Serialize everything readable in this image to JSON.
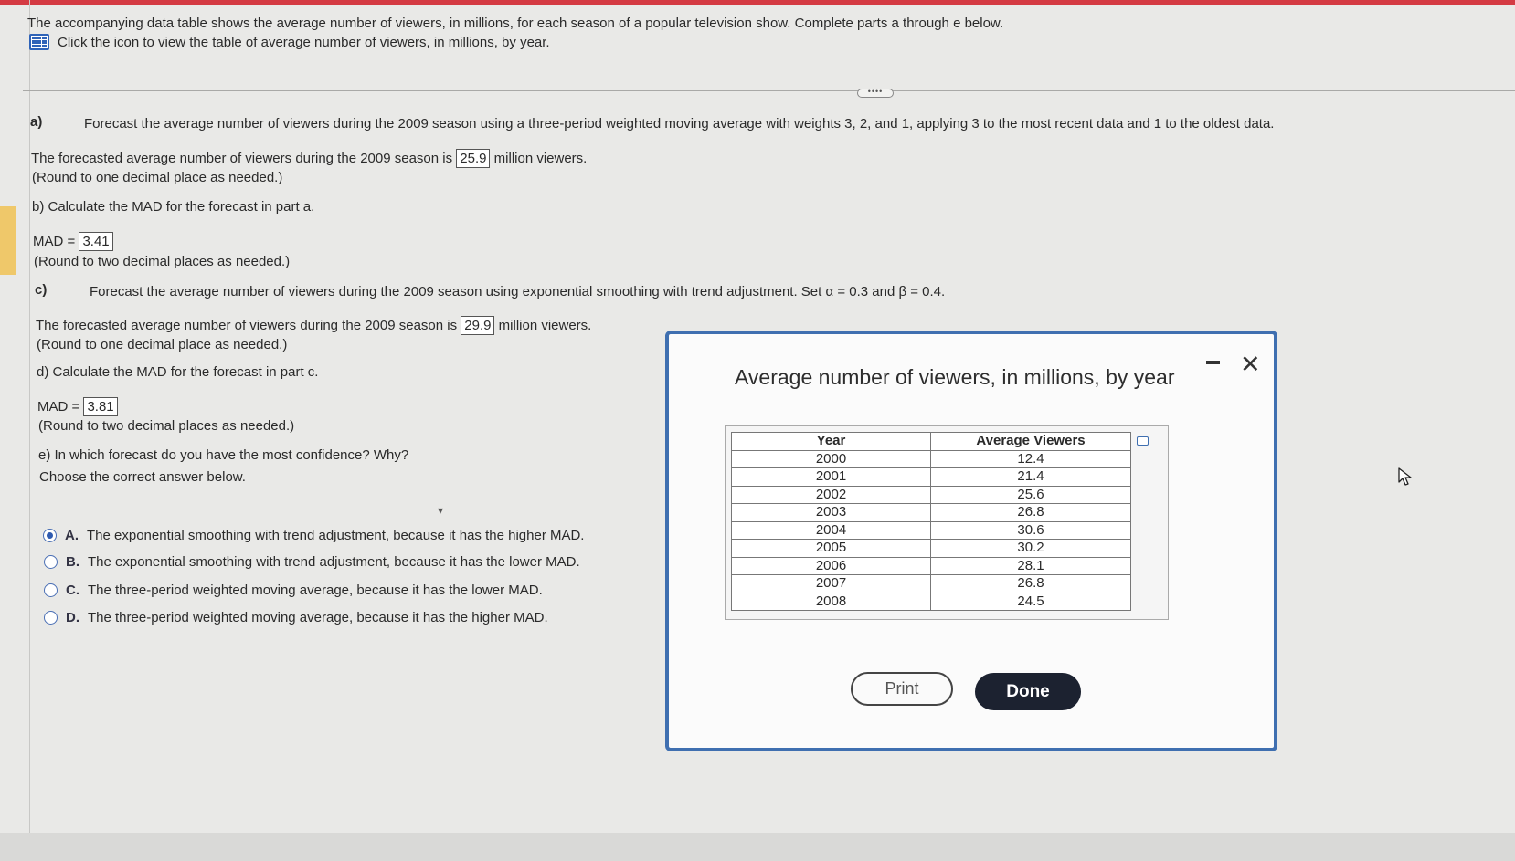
{
  "intro": {
    "text": "The accompanying data table shows the average number of viewers, in millions, for each season of a popular television show. Complete parts a through e below.",
    "table_link": "Click the icon to view the table of average number of viewers, in millions, by year."
  },
  "part_a": {
    "letter": "a)",
    "question": "Forecast the average number of viewers during the 2009 season using a three-period weighted moving average with weights 3, 2, and 1, applying 3 to the most recent data and 1 to the oldest data.",
    "answer_prefix": "The forecasted average number of viewers during the 2009 season is",
    "answer_value": "25.9",
    "answer_suffix": "million viewers.",
    "hint": "(Round to one decimal place as needed.)"
  },
  "part_b": {
    "question": "b) Calculate the MAD for the forecast in part a.",
    "label": "MAD =",
    "answer_value": "3.41",
    "hint": "(Round to two decimal places as needed.)"
  },
  "part_c": {
    "letter": "c)",
    "question": "Forecast the average number of viewers during the 2009 season using exponential smoothing with trend adjustment. Set α = 0.3 and β = 0.4.",
    "answer_prefix": "The forecasted average number of viewers during the 2009 season is",
    "answer_value": "29.9",
    "answer_suffix": "million viewers.",
    "hint": "(Round to one decimal place as needed.)"
  },
  "part_d": {
    "question": "d) Calculate the MAD for the forecast in part c.",
    "label": "MAD =",
    "answer_value": "3.81",
    "hint": "(Round to two decimal places as needed.)"
  },
  "part_e": {
    "question": "e) In which forecast do you have the most confidence? Why?",
    "instruction": "Choose the correct answer below.",
    "choices": [
      {
        "letter": "A.",
        "text": "The exponential smoothing with trend adjustment, because it has the higher MAD.",
        "selected": true
      },
      {
        "letter": "B.",
        "text": "The exponential smoothing with trend adjustment, because it has the lower MAD.",
        "selected": false
      },
      {
        "letter": "C.",
        "text": "The three-period weighted moving average, because it has the lower MAD.",
        "selected": false
      },
      {
        "letter": "D.",
        "text": "The three-period weighted moving average, because it has the higher MAD.",
        "selected": false
      }
    ]
  },
  "dialog": {
    "title": "Average number of viewers, in millions, by year",
    "table": {
      "headers": [
        "Year",
        "Average Viewers"
      ],
      "rows": [
        [
          "2000",
          "12.4"
        ],
        [
          "2001",
          "21.4"
        ],
        [
          "2002",
          "25.6"
        ],
        [
          "2003",
          "26.8"
        ],
        [
          "2004",
          "30.6"
        ],
        [
          "2005",
          "30.2"
        ],
        [
          "2006",
          "28.1"
        ],
        [
          "2007",
          "26.8"
        ],
        [
          "2008",
          "24.5"
        ]
      ]
    },
    "print_label": "Print",
    "done_label": "Done"
  },
  "colors": {
    "accent_red": "#d43a43",
    "link_blue": "#2f63b8",
    "dialog_border": "#3f6fb0",
    "done_button": "#1c2230",
    "highlight": "#efc86a"
  },
  "icons": [
    "table-grid-icon",
    "expand-dots-icon",
    "minimize-icon",
    "close-icon",
    "copy-icon",
    "mouse-pointer-icon"
  ]
}
